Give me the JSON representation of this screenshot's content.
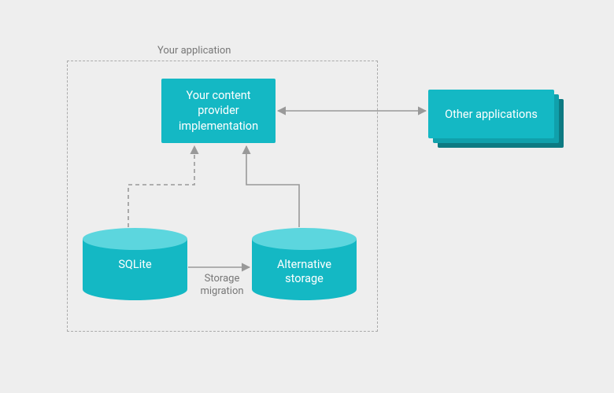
{
  "container_label": "Your application",
  "provider_box": "Your content\nprovider\nimplementation",
  "other_apps": "Other applications",
  "sqlite": "SQLite",
  "alt_storage": "Alternative\nstorage",
  "migration": "Storage\nmigration"
}
